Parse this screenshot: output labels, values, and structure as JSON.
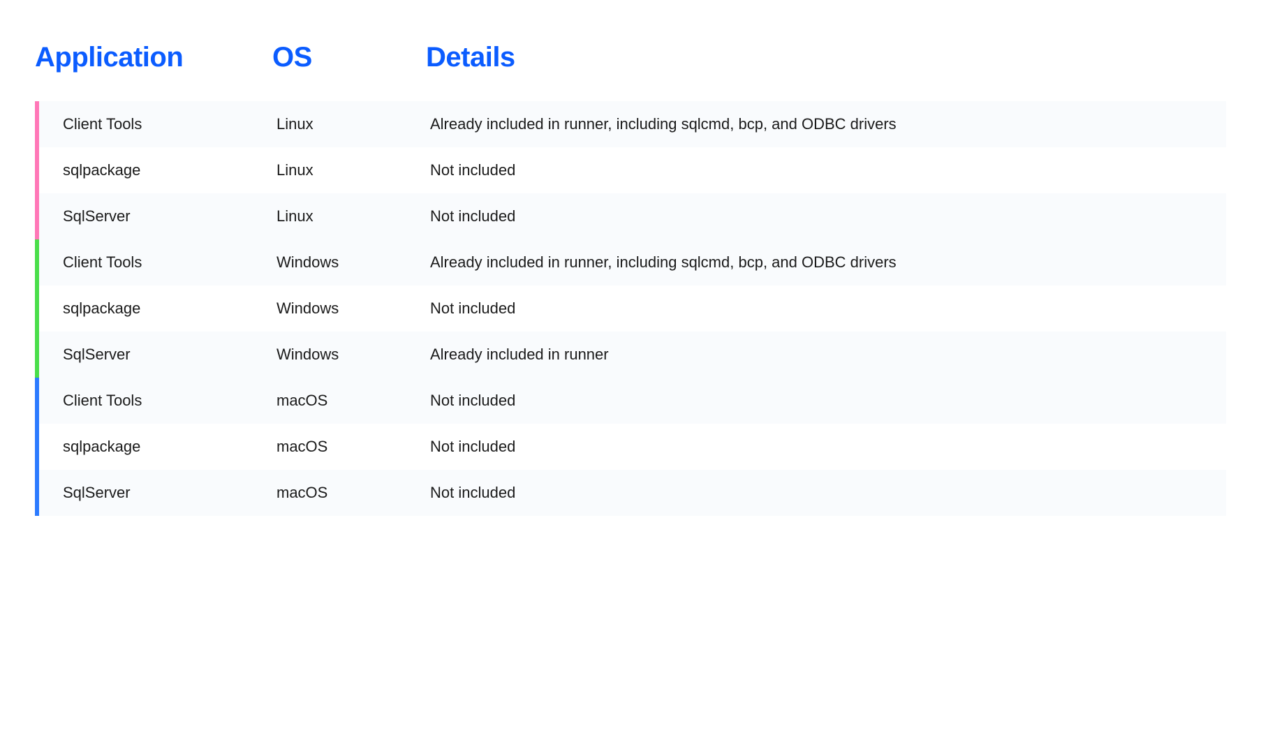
{
  "headers": {
    "application": "Application",
    "os": "OS",
    "details": "Details"
  },
  "groups": [
    {
      "color": "pink",
      "rows": [
        {
          "application": "Client Tools",
          "os": "Linux",
          "details": "Already included in runner, including sqlcmd, bcp, and ODBC drivers"
        },
        {
          "application": "sqlpackage",
          "os": "Linux",
          "details": "Not included"
        },
        {
          "application": "SqlServer",
          "os": "Linux",
          "details": "Not included"
        }
      ]
    },
    {
      "color": "green",
      "rows": [
        {
          "application": "Client Tools",
          "os": "Windows",
          "details": "Already included in runner, including sqlcmd, bcp, and ODBC drivers"
        },
        {
          "application": "sqlpackage",
          "os": "Windows",
          "details": "Not included"
        },
        {
          "application": "SqlServer",
          "os": "Windows",
          "details": "Already included in runner"
        }
      ]
    },
    {
      "color": "blue",
      "rows": [
        {
          "application": "Client Tools",
          "os": "macOS",
          "details": "Not included"
        },
        {
          "application": "sqlpackage",
          "os": "macOS",
          "details": "Not included"
        },
        {
          "application": "SqlServer",
          "os": "macOS",
          "details": "Not included"
        }
      ]
    }
  ]
}
